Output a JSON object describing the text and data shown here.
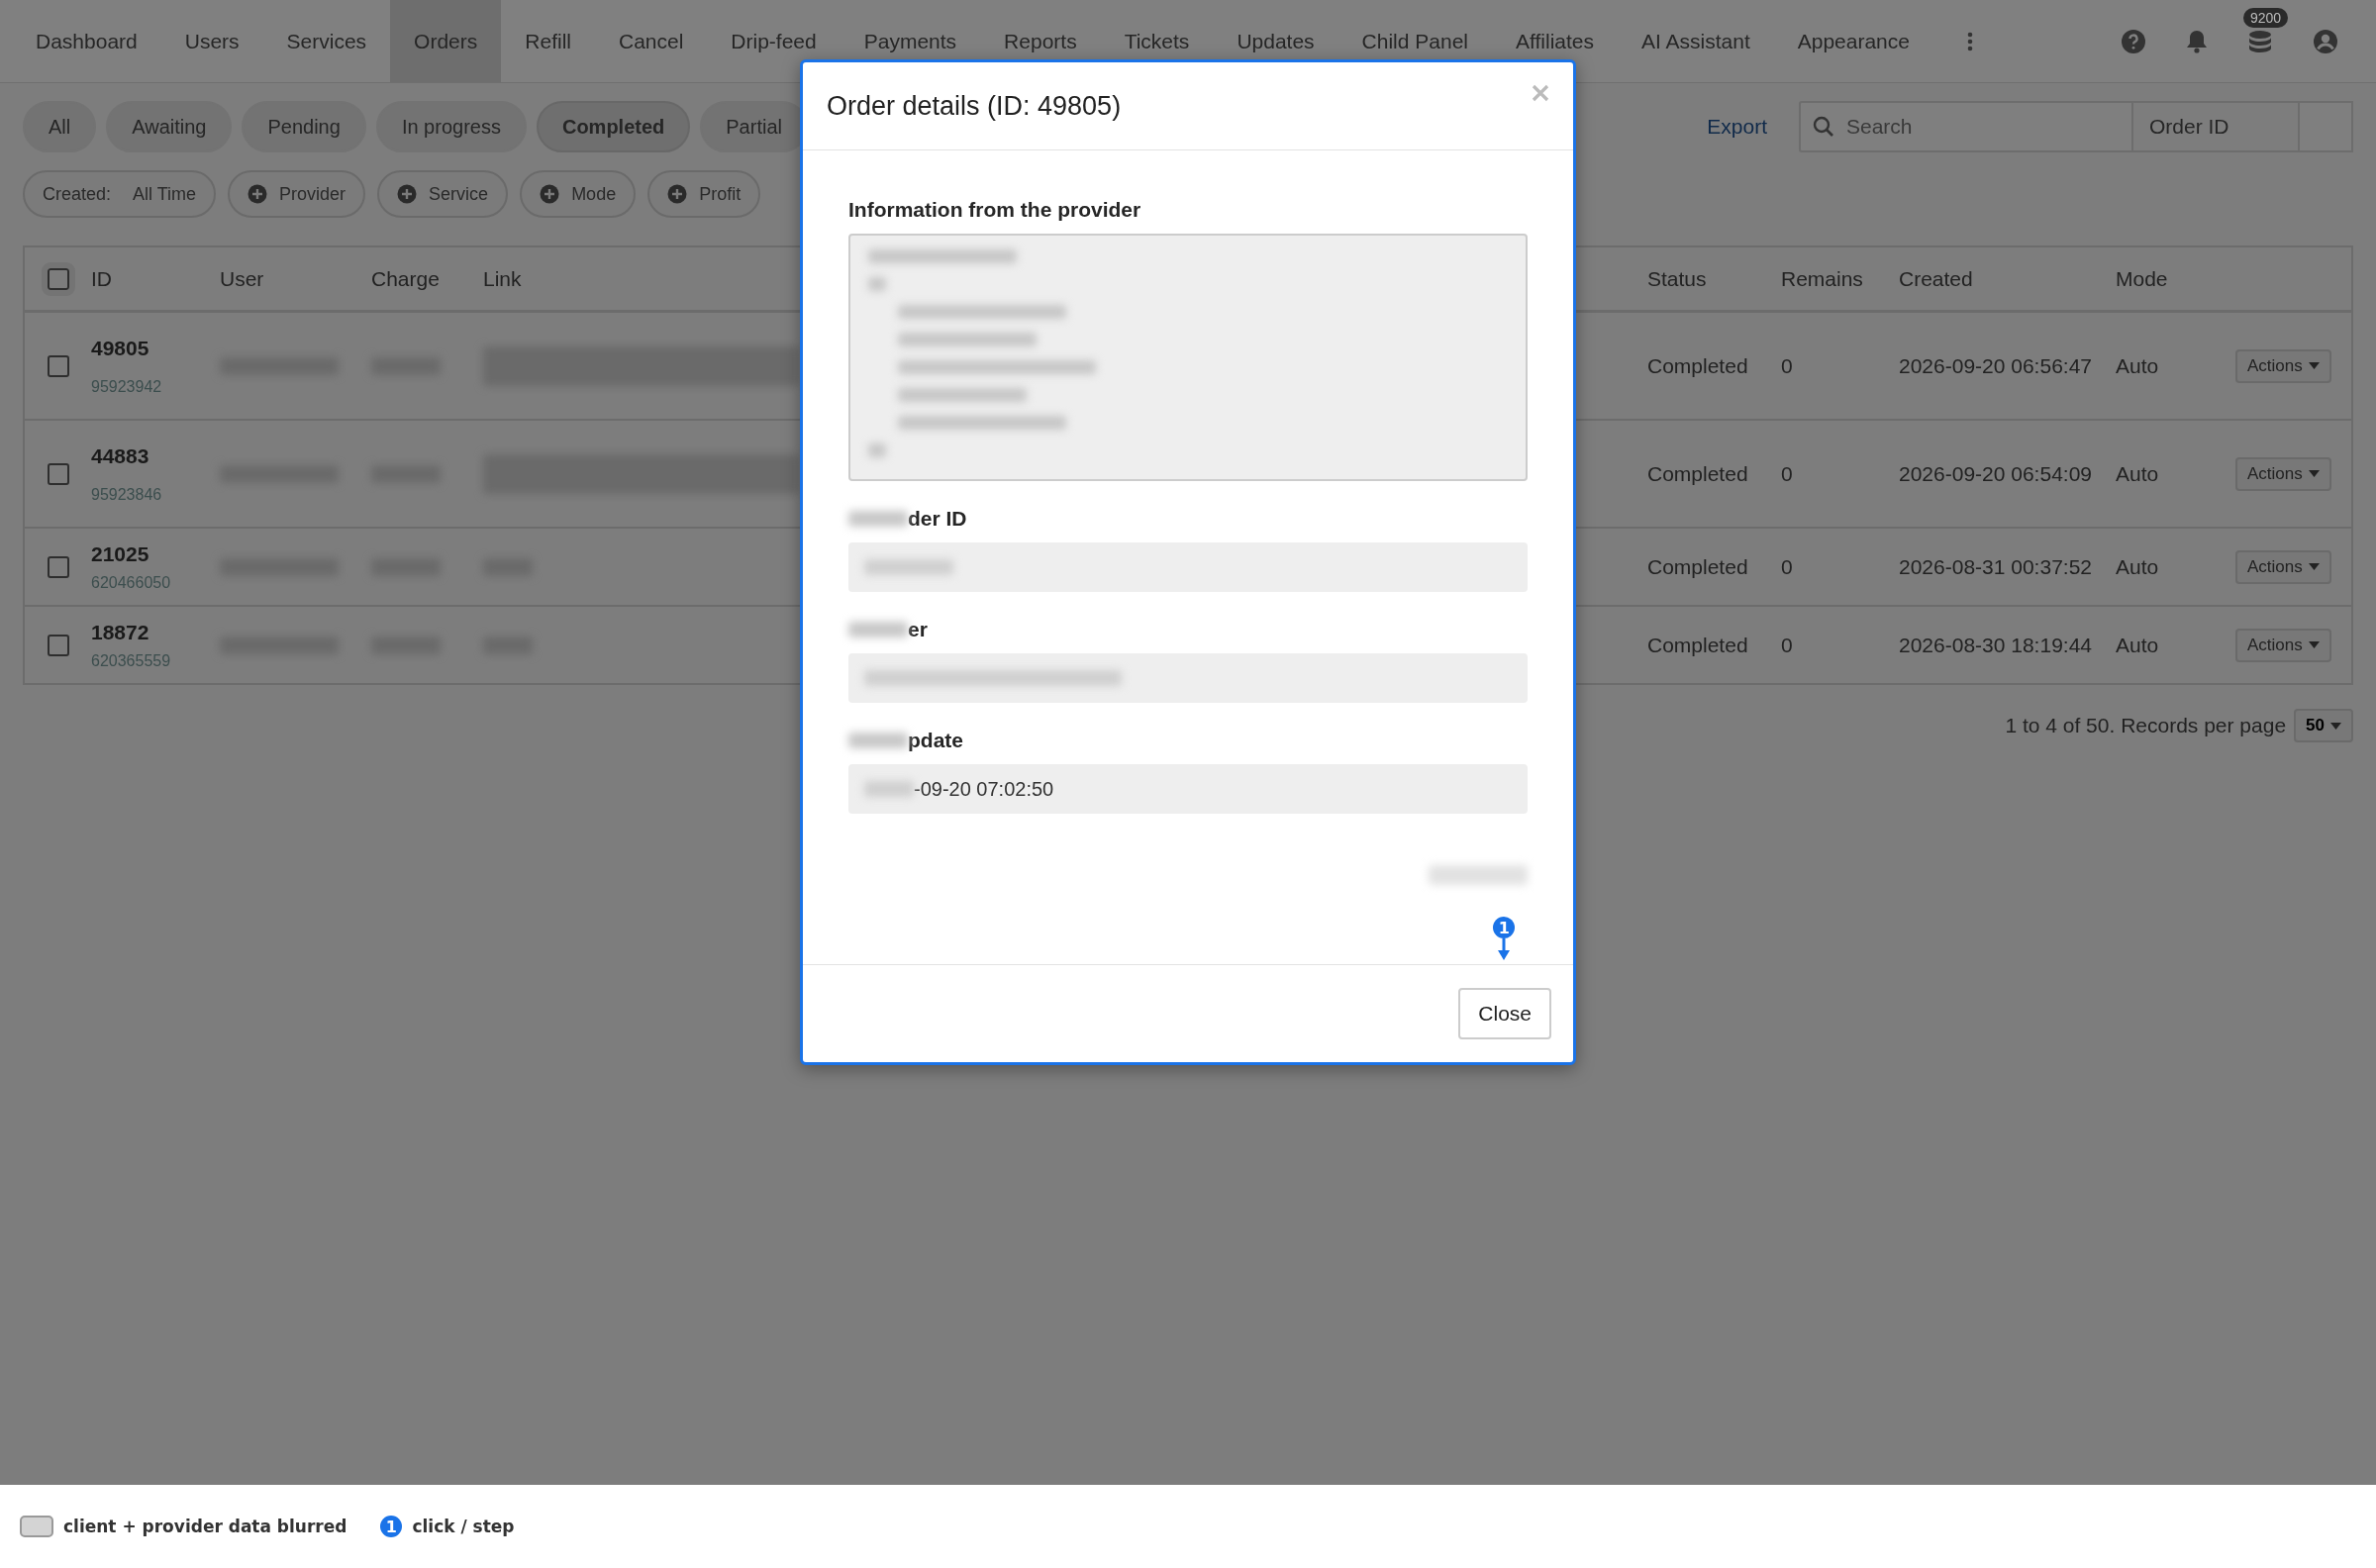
{
  "nav": {
    "items": [
      {
        "label": "Dashboard",
        "selected": false
      },
      {
        "label": "Users",
        "selected": false
      },
      {
        "label": "Services",
        "selected": false
      },
      {
        "label": "Orders",
        "selected": true
      },
      {
        "label": "Refill",
        "selected": false
      },
      {
        "label": "Cancel",
        "selected": false
      },
      {
        "label": "Drip-feed",
        "selected": false
      },
      {
        "label": "Payments",
        "selected": false
      },
      {
        "label": "Reports",
        "selected": false
      },
      {
        "label": "Tickets",
        "selected": false
      },
      {
        "label": "Updates",
        "selected": false
      },
      {
        "label": "Child Panel",
        "selected": false
      },
      {
        "label": "Affiliates",
        "selected": false
      },
      {
        "label": "AI Assistant",
        "selected": false
      },
      {
        "label": "Appearance",
        "selected": false
      }
    ],
    "balance_badge": "9200"
  },
  "status_tabs": [
    {
      "label": "All",
      "selected": false
    },
    {
      "label": "Awaiting",
      "selected": false
    },
    {
      "label": "Pending",
      "selected": false
    },
    {
      "label": "In progress",
      "selected": false
    },
    {
      "label": "Completed",
      "selected": true
    },
    {
      "label": "Partial",
      "selected": false
    }
  ],
  "export": "Export",
  "search": {
    "placeholder": "Search",
    "type": "Order ID"
  },
  "filters": [
    {
      "kind": "value",
      "label": "Created:",
      "value": "All Time"
    },
    {
      "kind": "add",
      "label": "Provider"
    },
    {
      "kind": "add",
      "label": "Service"
    },
    {
      "kind": "add",
      "label": "Mode"
    },
    {
      "kind": "add",
      "label": "Profit"
    }
  ],
  "table": {
    "select_all_checked": false,
    "columns": [
      "ID",
      "User",
      "Charge",
      "Link",
      "Status",
      "Remains",
      "Created",
      "Mode"
    ],
    "rows": [
      {
        "checked": false,
        "id": "49805",
        "external_id": "95923942",
        "status": "Completed",
        "remains": "0",
        "created": "2026-09-20 06:56:47",
        "mode": "Auto",
        "action": "Actions"
      },
      {
        "checked": false,
        "id": "44883",
        "external_id": "95923846",
        "status": "Completed",
        "remains": "0",
        "created": "2026-09-20 06:54:09",
        "mode": "Auto",
        "action": "Actions"
      },
      {
        "checked": false,
        "id": "21025",
        "external_id": "620466050",
        "status": "Completed",
        "remains": "0",
        "created": "2026-08-31 00:37:52",
        "mode": "Auto",
        "action": "Actions"
      },
      {
        "checked": false,
        "id": "18872",
        "external_id": "620365559",
        "status": "Completed",
        "remains": "0",
        "created": "2026-08-30 18:19:44",
        "mode": "Auto",
        "action": "Actions"
      }
    ]
  },
  "pagination": {
    "text": "1 to 4 of 50. Records per page",
    "per_page": "50"
  },
  "modal": {
    "title": "Order details (ID: 49805)",
    "info_label": "Information from the provider",
    "fields": [
      {
        "label": "der ID"
      },
      {
        "label": "er"
      },
      {
        "label": "pdate",
        "value": "-09-20 07:02:50"
      }
    ],
    "close_button": "Close",
    "step_marker": "1"
  },
  "legend": [
    {
      "kind": "swatch",
      "label": "client + provider data blurred"
    },
    {
      "kind": "step",
      "marker": "1",
      "label": "click / step"
    }
  ]
}
